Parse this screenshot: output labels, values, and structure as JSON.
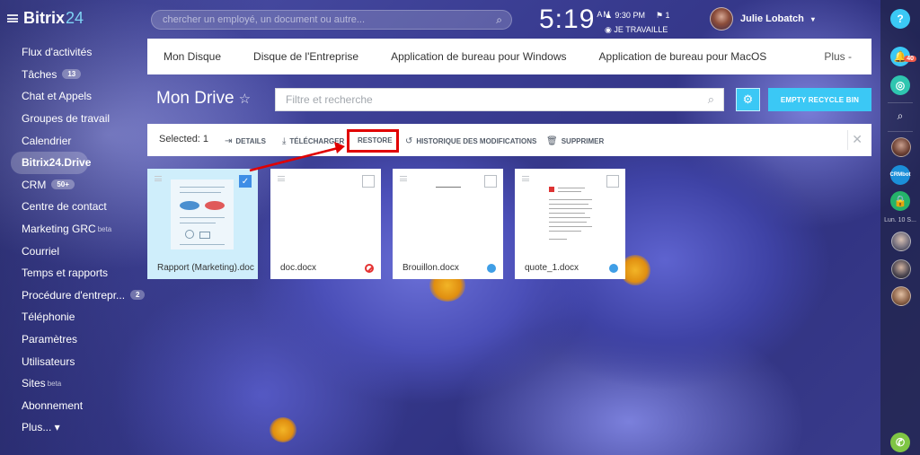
{
  "topbar": {
    "logo_main": "Bitrix",
    "logo_accent": "24",
    "search_placeholder": "chercher un employé, un document ou autre...",
    "clock_time": "5:19",
    "clock_ampm": "AM",
    "alarm_time": "9:30 PM",
    "flag_count": "1",
    "status": "JE TRAVAILLE",
    "user_name": "Julie Lobatch"
  },
  "sidebar": {
    "items": [
      {
        "label": "Flux d'activités"
      },
      {
        "label": "Tâches",
        "badge": "13"
      },
      {
        "label": "Chat et Appels"
      },
      {
        "label": "Groupes de travail"
      },
      {
        "label": "Calendrier"
      },
      {
        "label": "Bitrix24.Drive"
      },
      {
        "label": "CRM",
        "badge": "50+"
      },
      {
        "label": "Centre de contact"
      },
      {
        "label": "Marketing GRC",
        "sup": "beta"
      },
      {
        "label": "Courriel"
      },
      {
        "label": "Temps et rapports"
      },
      {
        "label": "Procédure d'entrepr...",
        "badge": "2"
      },
      {
        "label": "Téléphonie"
      },
      {
        "label": "Paramètres"
      },
      {
        "label": "Utilisateurs"
      },
      {
        "label": "Sites",
        "sup": "beta"
      },
      {
        "label": "Abonnement"
      },
      {
        "label": "Plus... ▾"
      }
    ]
  },
  "nav": {
    "tabs": [
      "Mon Disque",
      "Disque de l'Entreprise",
      "Application de bureau pour Windows",
      "Application de bureau pour MacOS"
    ],
    "more": "Plus -"
  },
  "main": {
    "title": "Mon Drive",
    "filter_placeholder": "Filtre et recherche",
    "empty_button": "EMPTY RECYCLE BIN"
  },
  "actions": {
    "selected": "Selected: 1",
    "details": "DETAILS",
    "download": "TÉLÉCHARGER",
    "restore": "RESTORE",
    "history": "HISTORIQUE DES MODIFICATIONS",
    "delete": "SUPPRIMER"
  },
  "files": [
    {
      "name": "Rapport (Marketing).doc",
      "selected": true,
      "status": "none"
    },
    {
      "name": "doc.docx",
      "selected": false,
      "status": "blocked"
    },
    {
      "name": "Brouillon.docx",
      "selected": false,
      "status": "shared"
    },
    {
      "name": "quote_1.docx",
      "selected": false,
      "status": "shared"
    }
  ],
  "rail": {
    "help": "?",
    "notif_count": "40",
    "date_label": "Lun. 10 S...",
    "crmbot": "CRMbot"
  },
  "colors": {
    "accent": "#3bc8f5",
    "restore_highlight": "#e10000",
    "checkbox_on": "#3f8ee6"
  }
}
